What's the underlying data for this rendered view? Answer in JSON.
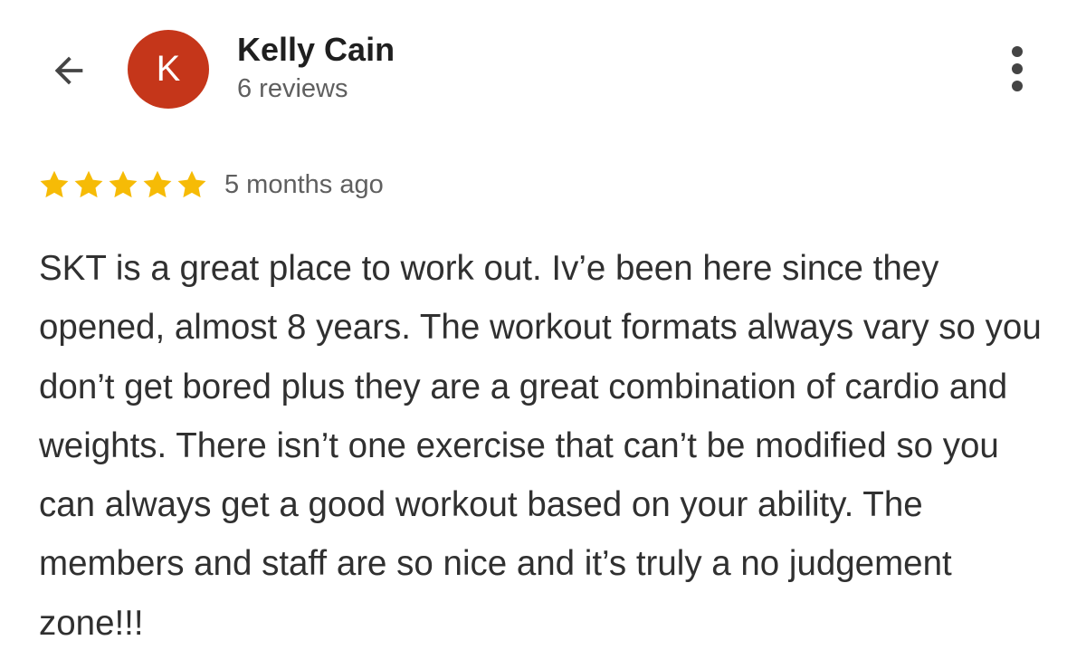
{
  "header": {
    "back_icon": "arrow-left-icon",
    "avatar": {
      "initial": "K",
      "color": "#c5361a"
    },
    "reviewer_name": "Kelly Cain",
    "review_count": "6 reviews",
    "more_icon": "more-vert-icon"
  },
  "review": {
    "rating": 5,
    "star_color": "#f6bb06",
    "date": "5 months ago",
    "text": "SKT is a great place to work out. Iv’e been here since they opened, almost 8 years. The workout formats always vary so you don’t get bored plus they are a great combination of cardio and weights. There isn’t one exercise that can’t be modified so you can always get a good workout based on your ability. The members and staff are so nice and it’s truly a no judgement zone!!!"
  }
}
